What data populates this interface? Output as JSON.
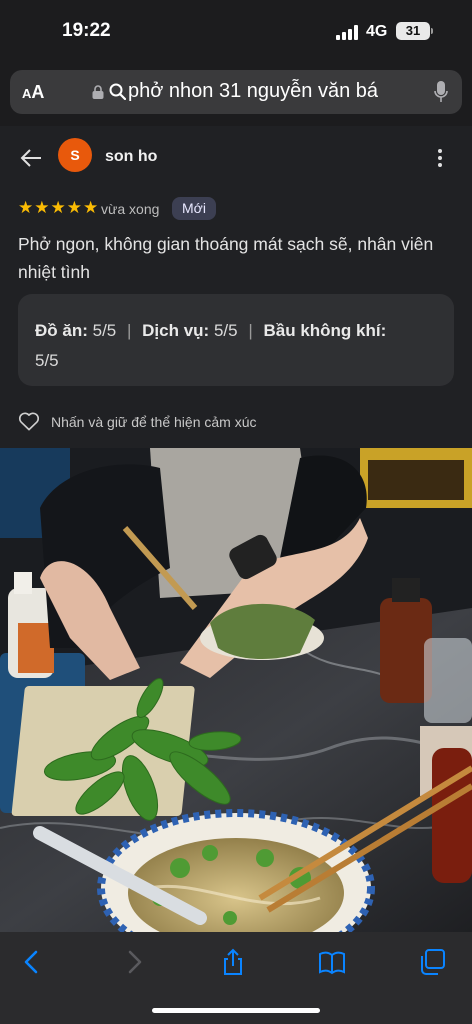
{
  "status": {
    "time": "19:22",
    "network": "4G",
    "battery": "31"
  },
  "url_bar": {
    "aa_label": "AA",
    "query": "phở nhon 31 nguyễn văn bá"
  },
  "review": {
    "avatar_letter": "S",
    "author": "son ho",
    "stars": "★★★★★",
    "time_ago": "vừa xong",
    "badge": "Mới",
    "text": "Phở ngon, không gian thoáng mát sạch sẽ, nhân viên nhiệt tình",
    "ratings": [
      {
        "label": "Đồ ăn:",
        "value": "5/5"
      },
      {
        "label": "Dịch vụ:",
        "value": "5/5"
      },
      {
        "label": "Bầu không khí:",
        "value": "5/5"
      }
    ],
    "reaction_hint": "Nhấn và giữ để thể hiện cảm xúc"
  },
  "photo": {
    "subject": "bowl of pho with fresh basil herbs on a marble table"
  },
  "colors": {
    "accent_blue": "#0a84ff",
    "star": "#fbbc04",
    "avatar": "#e8590c"
  },
  "toolbar": {
    "icons": [
      "back-icon",
      "forward-icon",
      "share-icon",
      "bookmarks-icon",
      "tabs-icon"
    ]
  }
}
